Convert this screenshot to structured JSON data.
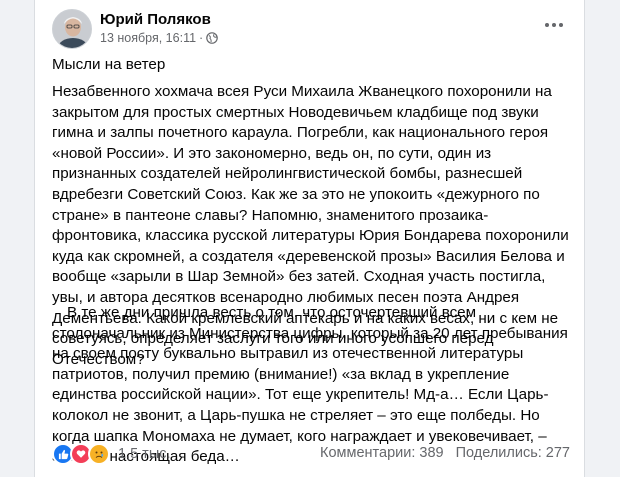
{
  "post": {
    "author": "Юрий Поляков",
    "date": "13 ноября, 16:11",
    "separator": "·",
    "headline": "Мысли на ветер",
    "paragraph1": "Незабвенного хохмача всея Руси Михаила Жванецкого похоронили на закрытом для простых смертных Новодевичьем кладбище под звуки гимна и залпы почетного караула. Погребли, как национального героя «новой России». И это закономерно, ведь он, по сути, один из признанных создателей нейролингвистической бомбы, разнесшей вдребезги Советский Союз. Как же за это не упокоить «дежурного по стране» в пантеоне славы? Напомню, знаменитого прозаика-фронтовика, классика русской литературы Юрия Бондарева похоронили куда как скромней, а создателя «деревенской прозы» Василия Белова и вообще «зарыли в Шар Земной» без затей. Сходная участь постигла, увы, и автора десятков всенародно любимых песен поэта Андрея Дементьева. Какой кремлевский аптекарь и на каких весах, ни с кем не советуясь,  определяет заслуги того или иного усопшего перед Отечеством?",
    "paragraph2": "В те же дни пришла весть о том, что осточертевший всем столоначальник из Министерства цифры, который за 20 лет пребывания на своем посту буквально вытравил из отечественной литературы патриотов, получил премию (внимание!) «за вклад в укрепление единства российской нации». Тот еще укрепитель! Мд-а… Если Царь-колокол не звонит, а Царь-пушка не стреляет – это еще полбеды.  Но когда шапка Мономаха не думает, кого награждает и увековечивает, – это уже настоящая беда…"
  },
  "footer": {
    "reactions_count": "1,5 тыс.",
    "comments": "Комментарии: 389",
    "shares": "Поделились: 277"
  },
  "icons": [
    "globe-icon",
    "more-icon",
    "like-icon",
    "love-icon",
    "sad-icon"
  ],
  "colors": {
    "background": "#f0f2f5",
    "card": "#ffffff",
    "secondary_text": "#65676b",
    "like": "#1877f2",
    "love": "#f33e58",
    "sad": "#f7b125"
  }
}
